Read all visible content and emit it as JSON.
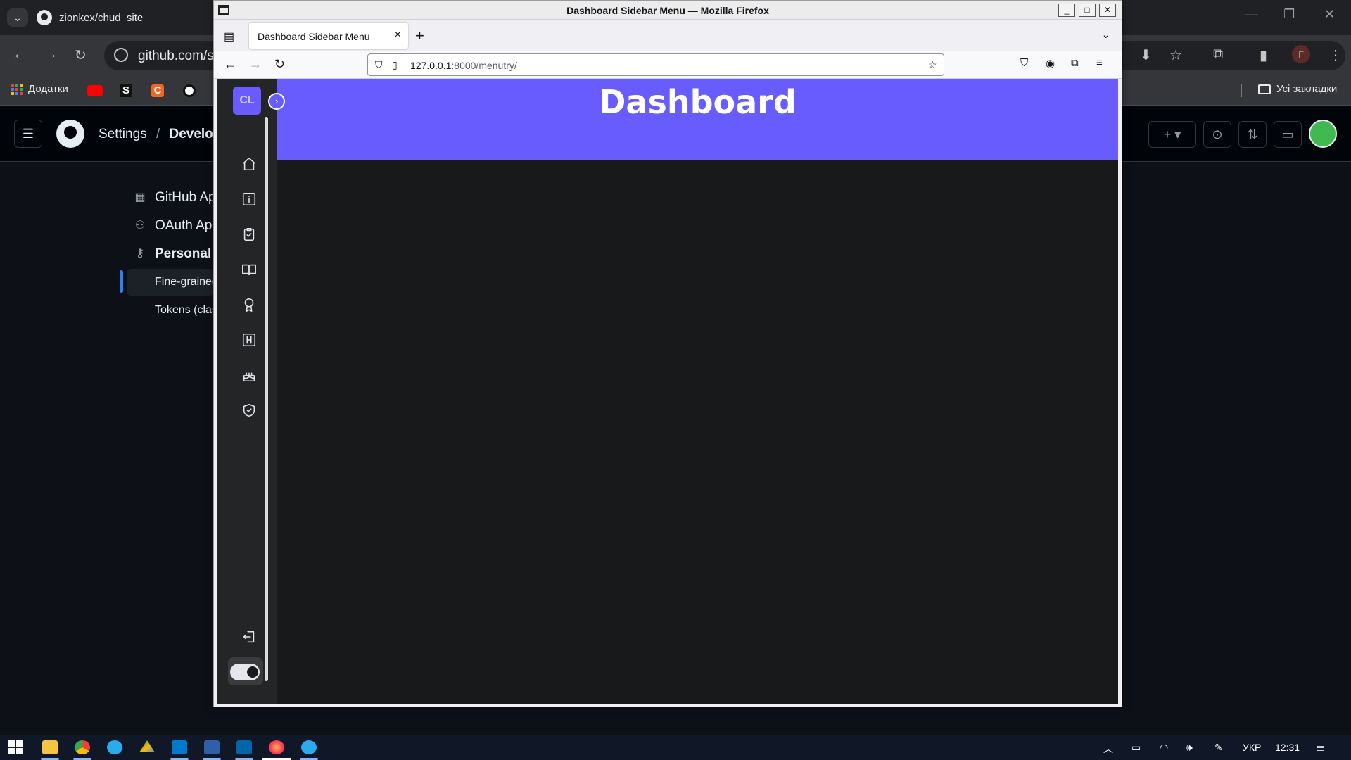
{
  "chrome": {
    "tab_title": "zionkex/chud_site",
    "address": "github.com/se",
    "bookmarks": [
      "Додатки"
    ],
    "all_bookmarks": "Усі закладки",
    "profile_letter": "Г"
  },
  "github": {
    "crumb_settings": "Settings",
    "crumb_separator": "/",
    "crumb_developer": "Develope",
    "nav": [
      "GitHub Ap",
      "OAuth App",
      "Personal a"
    ],
    "sub_nav": [
      "Fine-grained",
      "Tokens (class"
    ]
  },
  "firefox": {
    "window_title": "Dashboard Sidebar Menu — Mozilla Firefox",
    "tab_label": "Dashboard Sidebar Menu",
    "url_host": "127.0.0.1",
    "url_rest": ":8000/menutry/"
  },
  "page": {
    "logo_text": "CL",
    "header_title": "Dashboard",
    "dark_mode": true,
    "nav_icons": [
      "home-icon",
      "info-icon",
      "clipboard-check-icon",
      "book-icon",
      "award-icon",
      "hotel-icon",
      "cake-icon",
      "shield-check-icon"
    ],
    "accent_color": "#695cfe"
  },
  "taskbar": {
    "language": "УКР",
    "time": "12:31"
  }
}
